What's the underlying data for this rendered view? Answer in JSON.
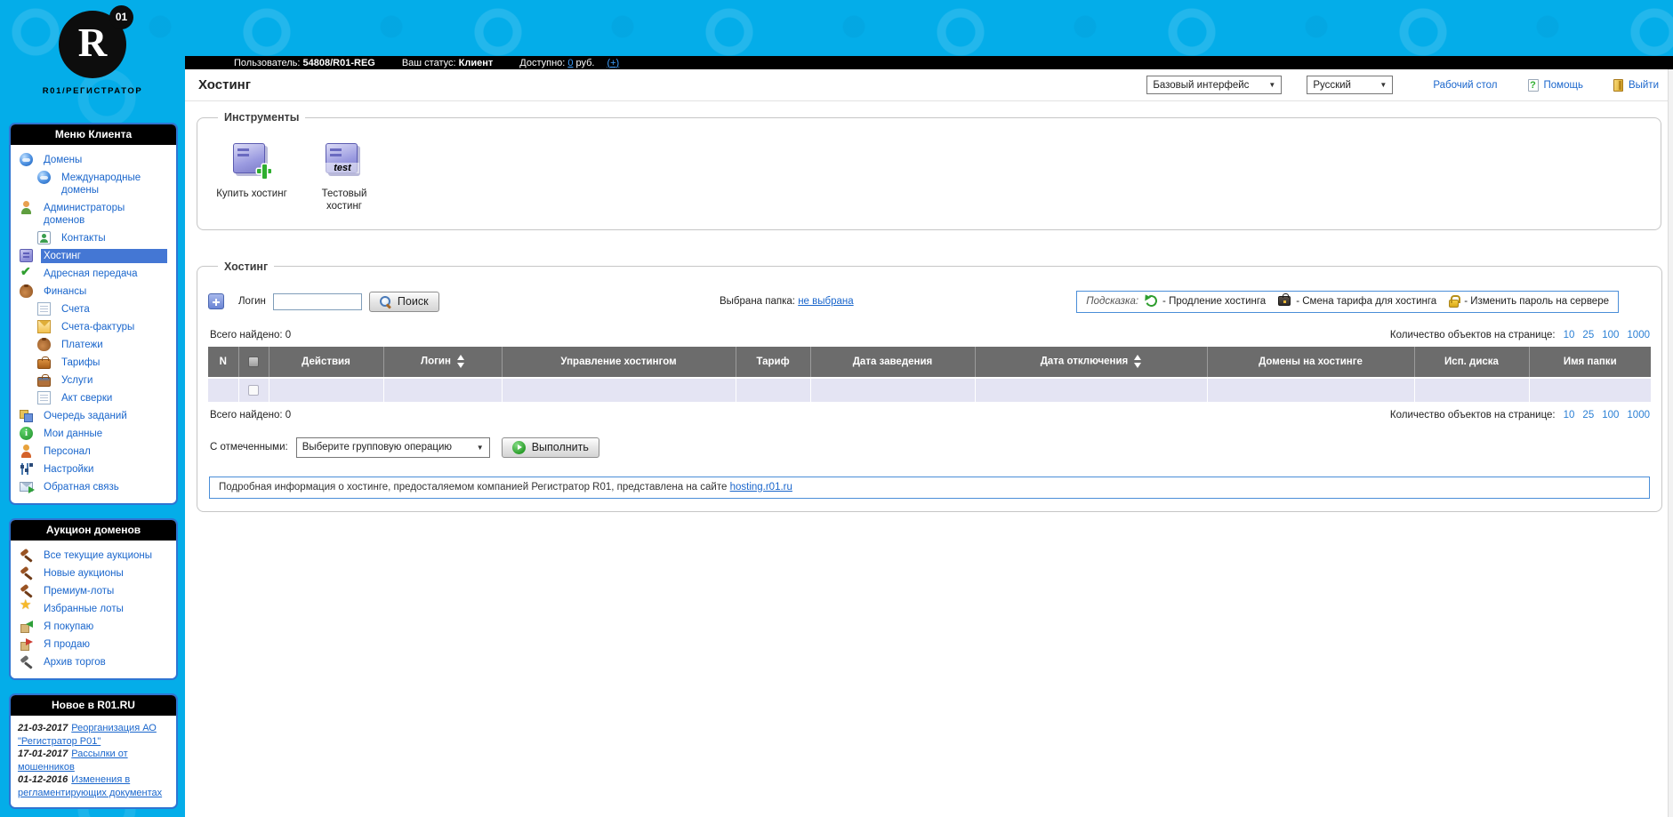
{
  "sidebar": {
    "logo": {
      "letter": "R",
      "badge": "01",
      "caption": "R01/РЕГИСТРАТОР"
    },
    "menu": {
      "title": "Меню Клиента",
      "items": [
        {
          "label": "Домены",
          "icon": "globe-icon",
          "level": 0
        },
        {
          "label": "Международные домены",
          "icon": "globe-icon",
          "level": 1
        },
        {
          "label": "Администраторы доменов",
          "icon": "admins-icon",
          "level": 0
        },
        {
          "label": "Контакты",
          "icon": "contact-icon",
          "level": 1
        },
        {
          "label": "Хостинг",
          "icon": "hosting-icon",
          "level": 0,
          "selected": true
        },
        {
          "label": "Адресная передача",
          "icon": "transfer-icon",
          "level": 0
        },
        {
          "label": "Финансы",
          "icon": "finance-icon",
          "level": 0
        },
        {
          "label": "Счета",
          "icon": "document-icon",
          "level": 1
        },
        {
          "label": "Счета-фактуры",
          "icon": "invoice-icon",
          "level": 1
        },
        {
          "label": "Платежи",
          "icon": "payments-icon",
          "level": 1
        },
        {
          "label": "Тарифы",
          "icon": "tariffs-icon",
          "level": 1
        },
        {
          "label": "Услуги",
          "icon": "services-icon",
          "level": 1
        },
        {
          "label": "Акт сверки",
          "icon": "document-icon",
          "level": 1
        },
        {
          "label": "Очередь заданий",
          "icon": "queue-icon",
          "level": 0
        },
        {
          "label": "Мои данные",
          "icon": "info-icon",
          "level": 0
        },
        {
          "label": "Персонал",
          "icon": "staff-icon",
          "level": 0
        },
        {
          "label": "Настройки",
          "icon": "settings-icon",
          "level": 0
        },
        {
          "label": "Обратная связь",
          "icon": "feedback-icon",
          "level": 0
        }
      ]
    },
    "auction": {
      "title": "Аукцион доменов",
      "items": [
        {
          "label": "Все текущие аукционы",
          "icon": "gavel-icon"
        },
        {
          "label": "Новые аукционы",
          "icon": "gavel-icon"
        },
        {
          "label": "Премиум-лоты",
          "icon": "gavel-icon"
        },
        {
          "label": "Избранные лоты",
          "icon": "star-icon"
        },
        {
          "label": "Я покупаю",
          "icon": "buy-icon"
        },
        {
          "label": "Я продаю",
          "icon": "sell-icon"
        },
        {
          "label": "Архив торгов",
          "icon": "gavel-gray-icon"
        }
      ]
    },
    "news": {
      "title": "Новое в R01.RU",
      "items": [
        {
          "date": "21-03-2017",
          "link": "Реорганизация АО \"Регистратор Р01\""
        },
        {
          "date": "17-01-2017",
          "link": "Рассылки от мошенников"
        },
        {
          "date": "01-12-2016",
          "link": "Изменения в регламентирующих документах"
        }
      ]
    }
  },
  "topbar": {
    "user_label": "Пользователь:",
    "user_value": "54808/R01-REG",
    "status_label": "Ваш статус:",
    "status_value": "Клиент",
    "balance_label": "Доступно:",
    "balance_link": "0",
    "balance_suffix": "руб.",
    "topup_link": "(+)"
  },
  "header": {
    "title": "Хостинг",
    "interface_select": "Базовый интерфейс",
    "language_select": "Русский",
    "desktop_link": "Рабочий стол",
    "help_link": "Помощь",
    "logout_link": "Выйти"
  },
  "tools": {
    "legend": "Инструменты",
    "items": [
      {
        "label": "Купить хостинг",
        "icon": "buy-hosting-icon"
      },
      {
        "label": "Тестовый хостинг",
        "icon": "test-hosting-icon",
        "badge": "test"
      }
    ]
  },
  "hosting": {
    "legend": "Хостинг",
    "search": {
      "login_label": "Логин",
      "login_value": "",
      "button": "Поиск"
    },
    "folder": {
      "label": "Выбрана папка:",
      "link": "не выбрана"
    },
    "hint": {
      "label": "Подсказка:",
      "items": [
        {
          "icon": "renew-icon",
          "text": "- Продление хостинга"
        },
        {
          "icon": "tariff-dark-icon",
          "text": "- Смена тарифа для хостинга"
        },
        {
          "icon": "lock-icon",
          "text": "- Изменить пароль на сервере"
        }
      ]
    },
    "found": {
      "label": "Всего найдено:",
      "value": "0"
    },
    "per_page": {
      "label": "Количество объектов на странице:",
      "options": [
        "10",
        "25",
        "100",
        "1000"
      ]
    },
    "table": {
      "headers": [
        {
          "label": "N"
        },
        {
          "label": "",
          "checkbox": true
        },
        {
          "label": "Действия"
        },
        {
          "label": "Логин",
          "sortable": true
        },
        {
          "label": "Управление хостингом"
        },
        {
          "label": "Тариф"
        },
        {
          "label": "Дата заведения"
        },
        {
          "label": "Дата отключения",
          "sortable": true
        },
        {
          "label": "Домены на хостинге"
        },
        {
          "label": "Исп. диска"
        },
        {
          "label": "Имя папки"
        }
      ]
    },
    "group": {
      "label": "С отмеченными:",
      "select_value": "Выберите групповую операцию",
      "execute": "Выполнить"
    },
    "info": {
      "text": "Подробная информация о хостинге, предосталяемом компанией Регистратор R01, представлена на сайте",
      "link": "hosting.r01.ru"
    }
  }
}
